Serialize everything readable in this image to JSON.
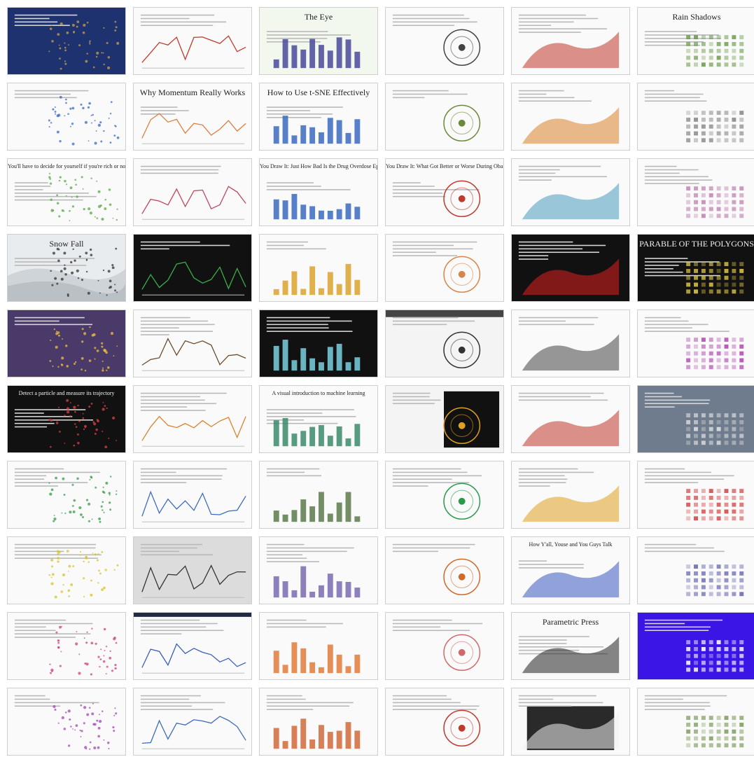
{
  "gallery": {
    "tiles": [
      {
        "title": "",
        "theme": "dark-blue",
        "accent": "#c9a24a"
      },
      {
        "title": "",
        "theme": "light",
        "accent": "#c0392b"
      },
      {
        "title": "The Eye",
        "theme": "mint",
        "accent": "#4a4a9a"
      },
      {
        "title": "",
        "theme": "light",
        "accent": "#444444"
      },
      {
        "title": "",
        "theme": "light",
        "accent": "#c0392b"
      },
      {
        "title": "Rain Shadows",
        "theme": "light",
        "accent": "#6a9a4a"
      },
      {
        "title": "",
        "theme": "light",
        "accent": "#3a6abf"
      },
      {
        "title": "Why Momentum Really Works",
        "theme": "light",
        "accent": "#e07b3a"
      },
      {
        "title": "How to Use t-SNE Effectively",
        "theme": "light",
        "accent": "#3a6abf"
      },
      {
        "title": "",
        "theme": "light",
        "accent": "#6a8a3a"
      },
      {
        "title": "",
        "theme": "light",
        "accent": "#d9822b"
      },
      {
        "title": "",
        "theme": "light",
        "accent": "#888888"
      },
      {
        "title": "You'll have to decide for yourself if you're rich or not.",
        "theme": "light",
        "accent": "#5aa84a"
      },
      {
        "title": "",
        "theme": "light",
        "accent": "#c0445a"
      },
      {
        "title": "You Draw It: Just How Bad Is the Drug Overdose Epidemic?",
        "theme": "light",
        "accent": "#3a6abf"
      },
      {
        "title": "You Draw It: What Got Better or Worse During Obama's Presidency",
        "theme": "light",
        "accent": "#c0392b"
      },
      {
        "title": "",
        "theme": "light",
        "accent": "#4a9abf"
      },
      {
        "title": "",
        "theme": "light",
        "accent": "#c084b0"
      },
      {
        "title": "Snow Fall",
        "theme": "snow",
        "accent": "#333333"
      },
      {
        "title": "",
        "theme": "black",
        "accent": "#3ab04a"
      },
      {
        "title": "",
        "theme": "light",
        "accent": "#d9a22b"
      },
      {
        "title": "",
        "theme": "light",
        "accent": "#d9844a"
      },
      {
        "title": "",
        "theme": "black",
        "accent": "#e02020"
      },
      {
        "title": "PARABLE OF THE POLYGONS",
        "theme": "black",
        "accent": "#e0c84a"
      },
      {
        "title": "",
        "theme": "purple",
        "accent": "#f0c040"
      },
      {
        "title": "",
        "theme": "light",
        "accent": "#6a4a2a"
      },
      {
        "title": "",
        "theme": "black",
        "accent": "#7ad0e0"
      },
      {
        "title": "",
        "theme": "grey-top",
        "accent": "#333333"
      },
      {
        "title": "",
        "theme": "light",
        "accent": "#444444"
      },
      {
        "title": "",
        "theme": "light",
        "accent": "#b04ab0"
      },
      {
        "title": "Detect a particle and measure its trajectory",
        "theme": "black",
        "accent": "#e0404a"
      },
      {
        "title": "",
        "theme": "light",
        "accent": "#d9822b"
      },
      {
        "title": "A visual introduction to machine learning",
        "theme": "light",
        "accent": "#3a8a6a"
      },
      {
        "title": "",
        "theme": "black-side",
        "accent": "#e0a020"
      },
      {
        "title": "",
        "theme": "light",
        "accent": "#c0392b"
      },
      {
        "title": "",
        "theme": "slate",
        "accent": "#e0e0e0"
      },
      {
        "title": "",
        "theme": "light",
        "accent": "#3a9a4a"
      },
      {
        "title": "",
        "theme": "light",
        "accent": "#3a6abf"
      },
      {
        "title": "",
        "theme": "light",
        "accent": "#5a7a4a"
      },
      {
        "title": "",
        "theme": "light",
        "accent": "#2a9a4a"
      },
      {
        "title": "",
        "theme": "light",
        "accent": "#e0a020"
      },
      {
        "title": "",
        "theme": "light",
        "accent": "#d04040"
      },
      {
        "title": "",
        "theme": "light",
        "accent": "#d9c22b"
      },
      {
        "title": "",
        "theme": "grey",
        "accent": "#333333"
      },
      {
        "title": "",
        "theme": "light",
        "accent": "#7a6ab0"
      },
      {
        "title": "",
        "theme": "light",
        "accent": "#d06a2b"
      },
      {
        "title": "How Y'all, Youse and You Guys Talk",
        "theme": "light",
        "accent": "#3a5abf"
      },
      {
        "title": "",
        "theme": "light",
        "accent": "#6a6ab0"
      },
      {
        "title": "",
        "theme": "light",
        "accent": "#d04080"
      },
      {
        "title": "",
        "theme": "navy-top",
        "accent": "#3a5abf"
      },
      {
        "title": "",
        "theme": "light",
        "accent": "#e07b3a"
      },
      {
        "title": "",
        "theme": "light",
        "accent": "#d06a6a"
      },
      {
        "title": "Parametric Press",
        "theme": "light",
        "accent": "#222222"
      },
      {
        "title": "",
        "theme": "violet",
        "accent": "#ffffff"
      },
      {
        "title": "",
        "theme": "light",
        "accent": "#a04ab0"
      },
      {
        "title": "",
        "theme": "light",
        "accent": "#3a6abf"
      },
      {
        "title": "",
        "theme": "light",
        "accent": "#d06a3a"
      },
      {
        "title": "",
        "theme": "light",
        "accent": "#c0392b"
      },
      {
        "title": "",
        "theme": "dark-card",
        "accent": "#f0f0f0"
      },
      {
        "title": "",
        "theme": "light",
        "accent": "#7a9a5a"
      }
    ]
  }
}
